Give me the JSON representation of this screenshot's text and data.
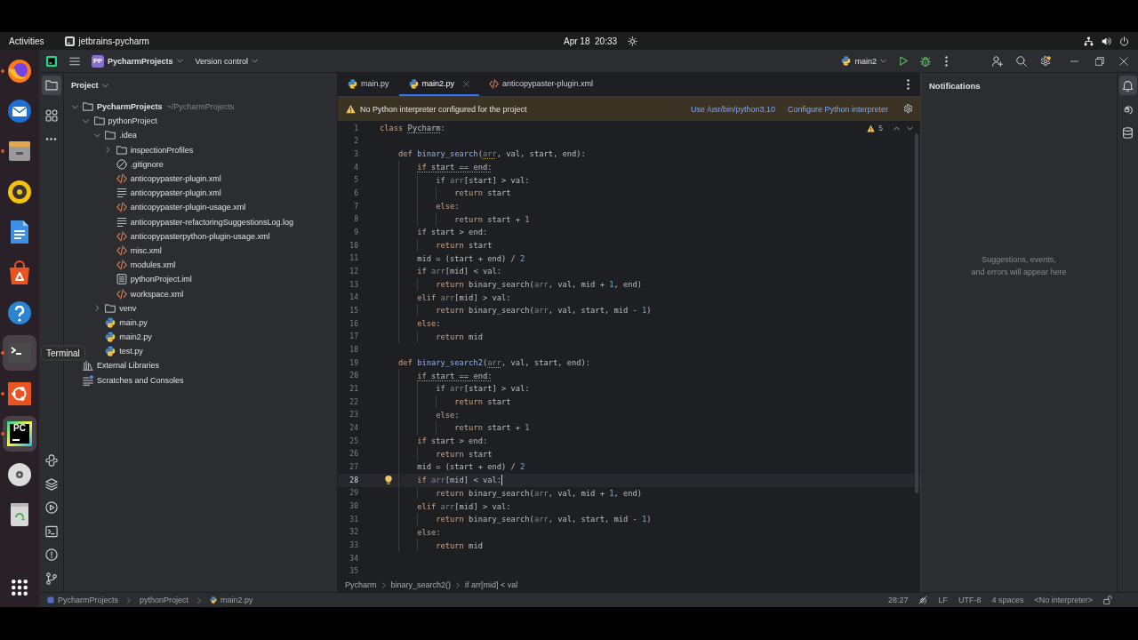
{
  "top_bar": {
    "activities": "Activities",
    "app_name": "jetbrains-pycharm",
    "clock": "Apr 18  20:33"
  },
  "dock": {
    "items": [
      {
        "kind": "browser",
        "running": true,
        "highlighted": false
      },
      {
        "kind": "mail",
        "running": false,
        "highlighted": false
      },
      {
        "kind": "files",
        "running": true,
        "highlighted": false
      },
      {
        "kind": "music",
        "running": false,
        "highlighted": false
      },
      {
        "kind": "document",
        "running": false,
        "highlighted": false
      },
      {
        "kind": "store",
        "running": false,
        "highlighted": false
      },
      {
        "kind": "help",
        "running": false,
        "highlighted": false
      },
      {
        "kind": "terminal",
        "running": true,
        "highlighted": true
      },
      {
        "kind": "ubuntu",
        "running": true,
        "highlighted": false
      },
      {
        "kind": "ide",
        "label": "PC",
        "running": true,
        "highlighted": true
      },
      {
        "kind": "disc",
        "running": false,
        "highlighted": false
      },
      {
        "kind": "trash",
        "running": false,
        "highlighted": false
      }
    ],
    "tooltip": "Terminal"
  },
  "toolbar": {
    "project_badge": "PP",
    "project": "PycharmProjects",
    "vcs": "Version control",
    "run_config": "main2"
  },
  "tool_strip": {
    "top": [
      {
        "kind": "project",
        "selected": true
      },
      {
        "kind": "structure",
        "selected": false
      },
      {
        "kind": "more",
        "selected": false
      }
    ],
    "bottom": [
      {
        "kind": "console",
        "selected": false
      },
      {
        "kind": "packages",
        "selected": false
      },
      {
        "kind": "services",
        "selected": false
      },
      {
        "kind": "terminal",
        "selected": false
      },
      {
        "kind": "problems",
        "selected": false
      },
      {
        "kind": "git",
        "selected": false
      }
    ]
  },
  "project_panel": {
    "title": "Project",
    "tree": [
      {
        "label": "PycharmProjects",
        "kind": "root",
        "path": "~/PycharmProjects",
        "expanded": true,
        "children": [
          {
            "label": "pythonProject",
            "kind": "folder",
            "expanded": true,
            "children": [
              {
                "label": ".idea",
                "kind": "folder",
                "expanded": true,
                "children": [
                  {
                    "label": "inspectionProfiles",
                    "kind": "folder",
                    "expanded": false
                  },
                  {
                    "label": ".gitignore",
                    "kind": "ignore"
                  },
                  {
                    "label": "anticopypaster-plugin.xml",
                    "kind": "xml"
                  },
                  {
                    "label": "anticopypaster-plugin.xml",
                    "kind": "text"
                  },
                  {
                    "label": "anticopypaster-plugin-usage.xml",
                    "kind": "xml"
                  },
                  {
                    "label": "anticopypaster-refactoringSuggestionsLog.log",
                    "kind": "text"
                  },
                  {
                    "label": "anticopypasterpython-plugin-usage.xml",
                    "kind": "xml"
                  },
                  {
                    "label": "misc.xml",
                    "kind": "xml"
                  },
                  {
                    "label": "modules.xml",
                    "kind": "xml"
                  },
                  {
                    "label": "pythonProject.iml",
                    "kind": "iml"
                  },
                  {
                    "label": "workspace.xml",
                    "kind": "xml"
                  }
                ]
              },
              {
                "label": "venv",
                "kind": "folder",
                "expanded": false
              },
              {
                "label": "main.py",
                "kind": "python"
              },
              {
                "label": "main2.py",
                "kind": "python"
              },
              {
                "label": "test.py",
                "kind": "python"
              }
            ]
          }
        ]
      },
      {
        "label": "External Libraries",
        "kind": "library"
      },
      {
        "label": "Scratches and Consoles",
        "kind": "scratches"
      }
    ]
  },
  "editor": {
    "tabs": [
      {
        "label": "main.py",
        "kind": "python",
        "selected": false
      },
      {
        "label": "main2.py",
        "kind": "python",
        "selected": true
      },
      {
        "label": "anticopypaster-plugin.xml",
        "kind": "xml",
        "selected": false
      }
    ],
    "banner": {
      "message": "No Python interpreter configured for the project",
      "actions": [
        "Use /usr/bin/python3.10",
        "Configure Python interpreter"
      ]
    },
    "warnings": "5",
    "lines": [
      {
        "number": "1",
        "current": false,
        "tokens": [
          {
            "text": "class ",
            "kind": "keyword",
            "flagged": false
          },
          {
            "text": "Pycharm",
            "kind": "plain",
            "flagged": true
          },
          {
            "text": ":",
            "kind": "plain",
            "flagged": false
          }
        ]
      },
      {
        "number": "2",
        "current": false
      },
      {
        "number": "3",
        "current": false,
        "tokens": [
          {
            "text": "    def ",
            "kind": "keyword",
            "flagged": false
          },
          {
            "text": "binary_search",
            "kind": "function",
            "flagged": false
          },
          {
            "text": "(",
            "kind": "plain",
            "flagged": false
          },
          {
            "text": "arr",
            "kind": "unused",
            "flagged": true
          },
          {
            "text": ", val, start, end):",
            "kind": "plain",
            "flagged": false
          }
        ]
      },
      {
        "number": "4",
        "current": false,
        "tokens": [
          {
            "text": "        if",
            "kind": "keyword",
            "flagged": true
          },
          {
            "text": " start == end:",
            "kind": "plain",
            "flagged": true
          }
        ]
      },
      {
        "number": "5",
        "current": false,
        "tokens": [
          {
            "text": "            if ",
            "kind": "keyword",
            "flagged": false
          },
          {
            "text": "arr",
            "kind": "unused",
            "flagged": false
          },
          {
            "text": "[start] > val:",
            "kind": "plain",
            "flagged": false
          }
        ]
      },
      {
        "number": "6",
        "current": false,
        "tokens": [
          {
            "text": "                return",
            "kind": "keyword",
            "flagged": false
          },
          {
            "text": " start",
            "kind": "plain",
            "flagged": false
          }
        ]
      },
      {
        "number": "7",
        "current": false,
        "tokens": [
          {
            "text": "            else",
            "kind": "keyword",
            "flagged": false
          },
          {
            "text": ":",
            "kind": "plain",
            "flagged": false
          }
        ]
      },
      {
        "number": "8",
        "current": false,
        "tokens": [
          {
            "text": "                return",
            "kind": "keyword",
            "flagged": false
          },
          {
            "text": " start + ",
            "kind": "plain",
            "flagged": false
          },
          {
            "text": "1",
            "kind": "number",
            "flagged": false
          }
        ]
      },
      {
        "number": "9",
        "current": false,
        "tokens": [
          {
            "text": "        if",
            "kind": "keyword",
            "flagged": false
          },
          {
            "text": " start > end:",
            "kind": "plain",
            "flagged": false
          }
        ]
      },
      {
        "number": "10",
        "current": false,
        "tokens": [
          {
            "text": "            return",
            "kind": "keyword",
            "flagged": false
          },
          {
            "text": " start",
            "kind": "plain",
            "flagged": false
          }
        ]
      },
      {
        "number": "11",
        "current": false,
        "tokens": [
          {
            "text": "        mid = (start + end) / ",
            "kind": "plain",
            "flagged": false
          },
          {
            "text": "2",
            "kind": "number",
            "flagged": false
          }
        ]
      },
      {
        "number": "12",
        "current": false,
        "tokens": [
          {
            "text": "        if ",
            "kind": "keyword",
            "flagged": false
          },
          {
            "text": "arr",
            "kind": "unused",
            "flagged": false
          },
          {
            "text": "[mid] < val:",
            "kind": "plain",
            "flagged": false
          }
        ]
      },
      {
        "number": "13",
        "current": false,
        "tokens": [
          {
            "text": "            return",
            "kind": "keyword",
            "flagged": false
          },
          {
            "text": " binary_search(",
            "kind": "plain",
            "flagged": false
          },
          {
            "text": "arr",
            "kind": "unused",
            "flagged": false
          },
          {
            "text": ", val, mid + ",
            "kind": "plain",
            "flagged": false
          },
          {
            "text": "1",
            "kind": "number",
            "flagged": false
          },
          {
            "text": ", end)",
            "kind": "plain",
            "flagged": false
          }
        ]
      },
      {
        "number": "14",
        "current": false,
        "tokens": [
          {
            "text": "        elif ",
            "kind": "keyword",
            "flagged": false
          },
          {
            "text": "arr",
            "kind": "unused",
            "flagged": false
          },
          {
            "text": "[mid] > val:",
            "kind": "plain",
            "flagged": false
          }
        ]
      },
      {
        "number": "15",
        "current": false,
        "tokens": [
          {
            "text": "            return",
            "kind": "keyword",
            "flagged": false
          },
          {
            "text": " binary_search(",
            "kind": "plain",
            "flagged": false
          },
          {
            "text": "arr",
            "kind": "unused",
            "flagged": false
          },
          {
            "text": ", val, start, mid - ",
            "kind": "plain",
            "flagged": false
          },
          {
            "text": "1",
            "kind": "number",
            "flagged": false
          },
          {
            "text": ")",
            "kind": "plain",
            "flagged": false
          }
        ]
      },
      {
        "number": "16",
        "current": false,
        "tokens": [
          {
            "text": "        else",
            "kind": "keyword",
            "flagged": false
          },
          {
            "text": ":",
            "kind": "plain",
            "flagged": false
          }
        ]
      },
      {
        "number": "17",
        "current": false,
        "tokens": [
          {
            "text": "            return",
            "kind": "keyword",
            "flagged": false
          },
          {
            "text": " mid",
            "kind": "plain",
            "flagged": false
          }
        ]
      },
      {
        "number": "18",
        "current": false
      },
      {
        "number": "19",
        "current": false,
        "tokens": [
          {
            "text": "    def ",
            "kind": "keyword",
            "flagged": false
          },
          {
            "text": "binary_search2",
            "kind": "function",
            "flagged": false
          },
          {
            "text": "(",
            "kind": "plain",
            "flagged": false
          },
          {
            "text": "arr",
            "kind": "unused",
            "flagged": true
          },
          {
            "text": ", val, start, end):",
            "kind": "plain",
            "flagged": false
          }
        ]
      },
      {
        "number": "20",
        "current": false,
        "tokens": [
          {
            "text": "        if",
            "kind": "keyword",
            "flagged": true
          },
          {
            "text": " start == end:",
            "kind": "plain",
            "flagged": true
          }
        ]
      },
      {
        "number": "21",
        "current": false,
        "tokens": [
          {
            "text": "            if ",
            "kind": "keyword",
            "flagged": false
          },
          {
            "text": "arr",
            "kind": "unused",
            "flagged": false
          },
          {
            "text": "[start] > val:",
            "kind": "plain",
            "flagged": false
          }
        ]
      },
      {
        "number": "22",
        "current": false,
        "tokens": [
          {
            "text": "                return",
            "kind": "keyword",
            "flagged": false
          },
          {
            "text": " start",
            "kind": "plain",
            "flagged": false
          }
        ]
      },
      {
        "number": "23",
        "current": false,
        "tokens": [
          {
            "text": "            else",
            "kind": "keyword",
            "flagged": false
          },
          {
            "text": ":",
            "kind": "plain",
            "flagged": false
          }
        ]
      },
      {
        "number": "24",
        "current": false,
        "tokens": [
          {
            "text": "                return",
            "kind": "keyword",
            "flagged": false
          },
          {
            "text": " start + ",
            "kind": "plain",
            "flagged": false
          },
          {
            "text": "1",
            "kind": "number",
            "flagged": false
          }
        ]
      },
      {
        "number": "25",
        "current": false,
        "tokens": [
          {
            "text": "        if",
            "kind": "keyword",
            "flagged": false
          },
          {
            "text": " start > end:",
            "kind": "plain",
            "flagged": false
          }
        ]
      },
      {
        "number": "26",
        "current": false,
        "tokens": [
          {
            "text": "            return",
            "kind": "keyword",
            "flagged": false
          },
          {
            "text": " start",
            "kind": "plain",
            "flagged": false
          }
        ]
      },
      {
        "number": "27",
        "current": false,
        "tokens": [
          {
            "text": "        mid = (start + end) / ",
            "kind": "plain",
            "flagged": false
          },
          {
            "text": "2",
            "kind": "number",
            "flagged": false
          }
        ]
      },
      {
        "number": "28",
        "current": true,
        "tokens": [
          {
            "text": "        if ",
            "kind": "keyword",
            "flagged": false
          },
          {
            "text": "arr",
            "kind": "unused",
            "flagged": false
          },
          {
            "text": "[mid] < val:",
            "kind": "plain",
            "flagged": false
          }
        ]
      },
      {
        "number": "29",
        "current": false,
        "tokens": [
          {
            "text": "            return",
            "kind": "keyword",
            "flagged": false
          },
          {
            "text": " binary_search(",
            "kind": "plain",
            "flagged": false
          },
          {
            "text": "arr",
            "kind": "unused",
            "flagged": false
          },
          {
            "text": ", val, mid + ",
            "kind": "plain",
            "flagged": false
          },
          {
            "text": "1",
            "kind": "number",
            "flagged": false
          },
          {
            "text": ", end)",
            "kind": "plain",
            "flagged": false
          }
        ]
      },
      {
        "number": "30",
        "current": false,
        "tokens": [
          {
            "text": "        elif ",
            "kind": "keyword",
            "flagged": false
          },
          {
            "text": "arr",
            "kind": "unused",
            "flagged": false
          },
          {
            "text": "[mid] > val:",
            "kind": "plain",
            "flagged": false
          }
        ]
      },
      {
        "number": "31",
        "current": false,
        "tokens": [
          {
            "text": "            return",
            "kind": "keyword",
            "flagged": false
          },
          {
            "text": " binary_search(",
            "kind": "plain",
            "flagged": false
          },
          {
            "text": "arr",
            "kind": "unused",
            "flagged": false
          },
          {
            "text": ", val, start, mid - ",
            "kind": "plain",
            "flagged": false
          },
          {
            "text": "1",
            "kind": "number",
            "flagged": false
          },
          {
            "text": ")",
            "kind": "plain",
            "flagged": false
          }
        ]
      },
      {
        "number": "32",
        "current": false,
        "tokens": [
          {
            "text": "        else",
            "kind": "keyword",
            "flagged": false
          },
          {
            "text": ":",
            "kind": "plain",
            "flagged": false
          }
        ]
      },
      {
        "number": "33",
        "current": false,
        "tokens": [
          {
            "text": "            return",
            "kind": "keyword",
            "flagged": false
          },
          {
            "text": " mid",
            "kind": "plain",
            "flagged": false
          }
        ]
      },
      {
        "number": "34",
        "current": false
      },
      {
        "number": "35",
        "current": false
      }
    ],
    "breadcrumbs": [
      "Pycharm",
      "binary_search2()",
      "if arr[mid] < val"
    ]
  },
  "notifications": {
    "title": "Notifications",
    "empty_text": "Suggestions, events,\nand errors will appear here"
  },
  "right_strip": [
    {
      "kind": "notifications",
      "selected": true
    },
    {
      "kind": "assistant",
      "selected": false
    },
    {
      "kind": "database",
      "selected": false
    }
  ],
  "status_bar": {
    "path": [
      {
        "label": "PycharmProjects",
        "kind": "project"
      },
      {
        "label": "pythonProject",
        "kind": "directory"
      },
      {
        "label": "main2.py",
        "kind": "python"
      }
    ],
    "position": "28:27",
    "line_separator": "LF",
    "encoding": "UTF-8",
    "indent": "4 spaces",
    "interpreter": "<No interpreter>"
  }
}
